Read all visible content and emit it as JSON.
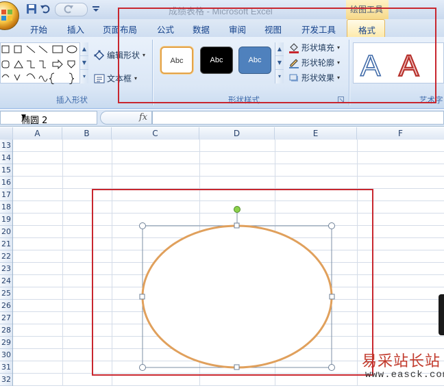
{
  "window": {
    "title": "成绩表格 - Microsoft Excel",
    "context_group": "绘图工具"
  },
  "tabs": [
    {
      "label": "开始"
    },
    {
      "label": "插入"
    },
    {
      "label": "页面布局"
    },
    {
      "label": "公式"
    },
    {
      "label": "数据"
    },
    {
      "label": "审阅"
    },
    {
      "label": "视图"
    },
    {
      "label": "开发工具"
    },
    {
      "label": "格式",
      "active": true
    }
  ],
  "ribbon": {
    "insert_shapes": {
      "label": "插入形状",
      "edit_shape": "编辑形状",
      "text_box": "文本框"
    },
    "shape_styles": {
      "label": "形状样式",
      "swatches": [
        "Abc",
        "Abc",
        "Abc"
      ],
      "shape_fill": "形状填充",
      "shape_outline": "形状轮廓",
      "shape_effects": "形状效果"
    },
    "art_styles": {
      "label": "艺术字"
    }
  },
  "formula_bar": {
    "name_box": "椭圆 2",
    "fx": "fx",
    "value": ""
  },
  "grid": {
    "columns": [
      "A",
      "B",
      "C",
      "D",
      "E",
      "F"
    ],
    "rows": [
      "13",
      "14",
      "15",
      "16",
      "17",
      "18",
      "19",
      "20",
      "21",
      "22",
      "23",
      "24",
      "25",
      "26",
      "27",
      "28",
      "29",
      "30",
      "31",
      "32"
    ]
  },
  "colors": {
    "annotation_red": "#c8262e",
    "ellipse_outline": "#e0a05c",
    "rotation_handle": "#8cd14a"
  },
  "watermark": {
    "site_name": "易采站长站",
    "url": "www.easck.com"
  }
}
